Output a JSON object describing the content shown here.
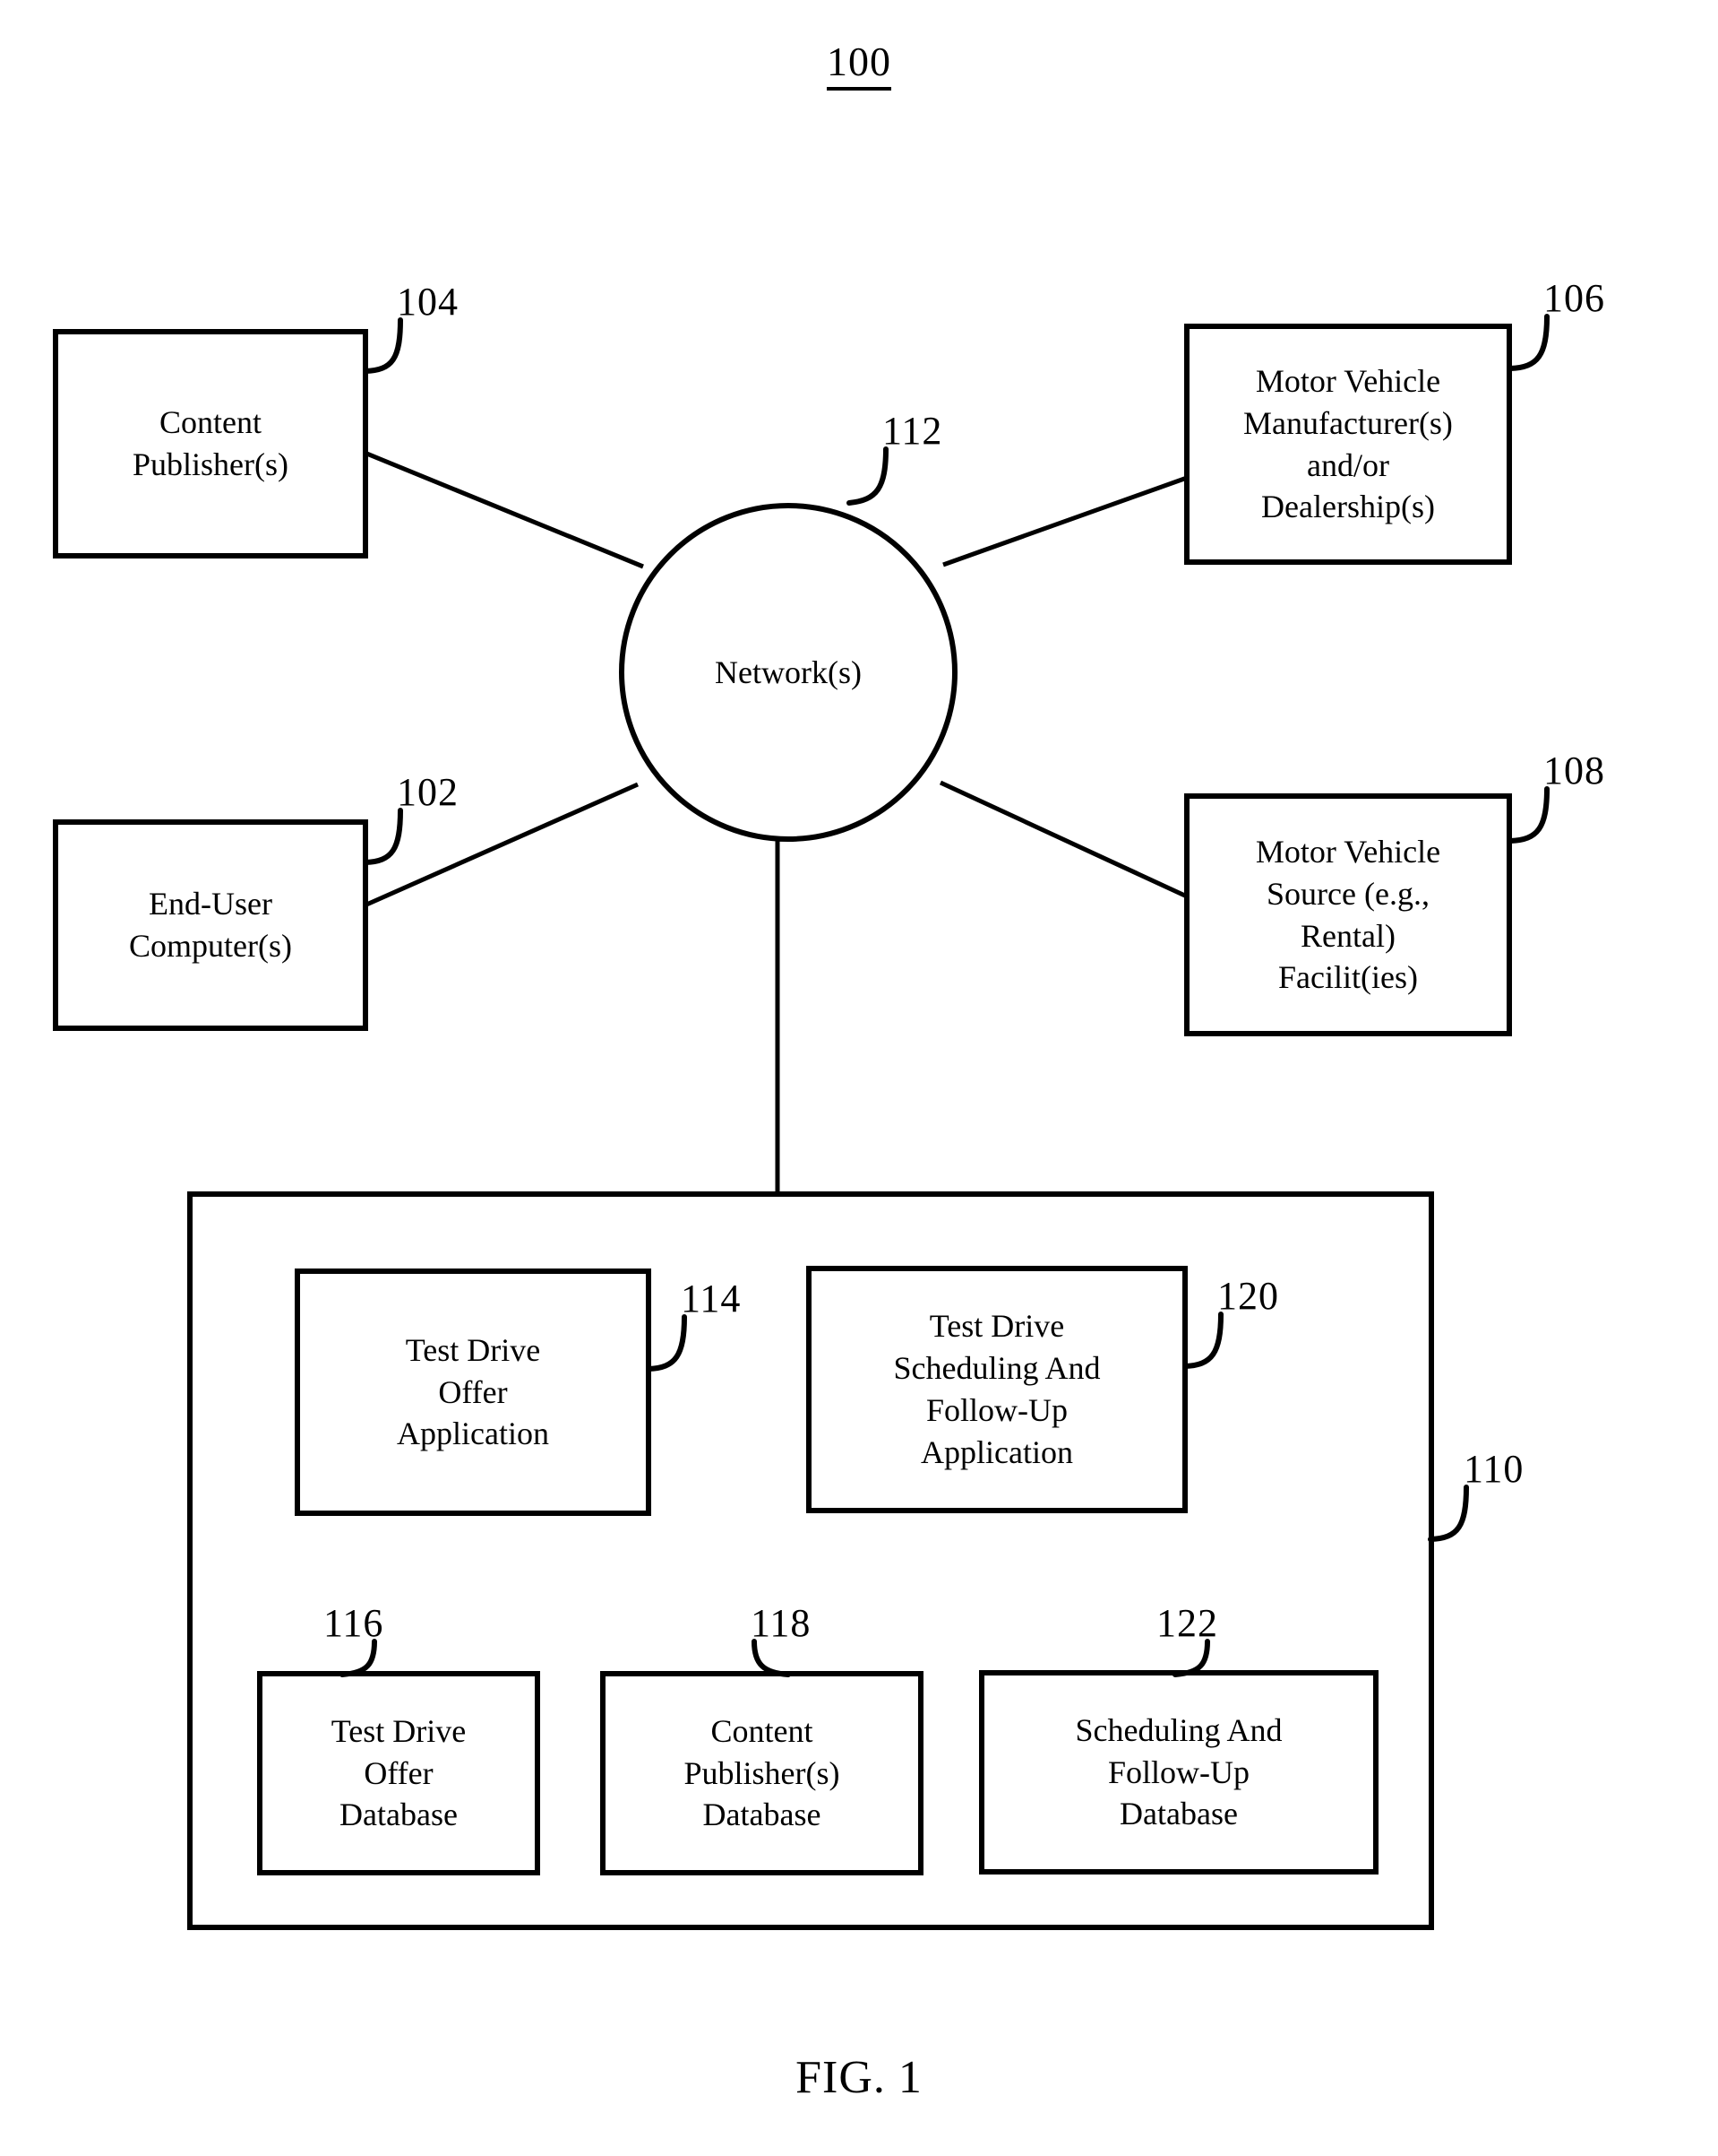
{
  "figure": {
    "number": "100",
    "caption": "FIG. 1"
  },
  "nodes": {
    "content_publishers": {
      "label": "Content\nPublisher(s)",
      "ref": "104"
    },
    "motor_vehicle_manufacturer": {
      "label": "Motor Vehicle\nManufacturer(s)\nand/or\nDealership(s)",
      "ref": "106"
    },
    "network": {
      "label": "Network(s)",
      "ref": "112"
    },
    "end_user_computers": {
      "label": "End-User\nComputer(s)",
      "ref": "102"
    },
    "motor_vehicle_source": {
      "label": "Motor Vehicle\nSource (e.g.,\nRental)\nFacilit(ies)",
      "ref": "108"
    },
    "server_container": {
      "label": "",
      "ref": "110"
    },
    "test_drive_offer_application": {
      "label": "Test Drive\nOffer\nApplication",
      "ref": "114"
    },
    "test_drive_scheduling_application": {
      "label": "Test Drive\nScheduling And\nFollow-Up\nApplication",
      "ref": "120"
    },
    "test_drive_offer_database": {
      "label": "Test Drive\nOffer\nDatabase",
      "ref": "116"
    },
    "content_publishers_database": {
      "label": "Content\nPublisher(s)\nDatabase",
      "ref": "118"
    },
    "scheduling_followup_database": {
      "label": "Scheduling And\nFollow-Up\nDatabase",
      "ref": "122"
    }
  },
  "colors": {
    "stroke": "#000000",
    "background": "#ffffff"
  }
}
